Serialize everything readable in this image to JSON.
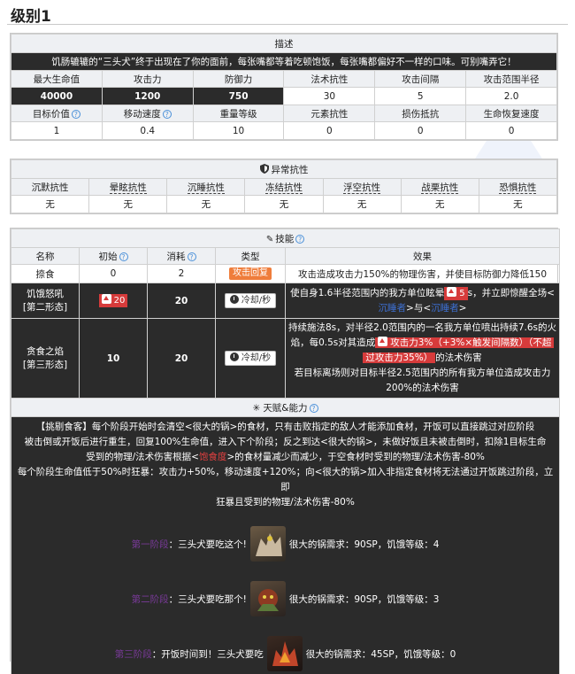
{
  "page": {
    "title": "级别1"
  },
  "desc": {
    "header": "描述",
    "text": "饥肠辘辘的“三头犬”终于出现在了你的面前，每张嘴都等着吃顿饱饭，每张嘴都偏好不一样的口味。可别嘴弄它！"
  },
  "stats": {
    "row1_labels": [
      "最大生命值",
      "攻击力",
      "防御力",
      "法术抗性",
      "攻击间隔",
      "攻击范围半径"
    ],
    "row1_values": [
      "40000",
      "1200",
      "750",
      "30",
      "5",
      "2.0"
    ],
    "row2_labels": [
      "目标价值",
      "移动速度",
      "重量等级",
      "元素抗性",
      "损伤抵抗",
      "生命恢复速度"
    ],
    "row2_values": [
      "1",
      "0.4",
      "10",
      "0",
      "0",
      "0"
    ]
  },
  "resist": {
    "header": "异常抗性",
    "labels": [
      "沉默抗性",
      "晕眩抗性",
      "沉睡抗性",
      "冻结抗性",
      "浮空抗性",
      "战栗抗性",
      "恐惧抗性"
    ],
    "values": [
      "无",
      "无",
      "无",
      "无",
      "无",
      "无",
      "无"
    ]
  },
  "skills": {
    "header": "技能",
    "cols": [
      "名称",
      "初始",
      "消耗",
      "类型",
      "效果"
    ],
    "row1": {
      "name": "捺食",
      "init": "0",
      "cost": "2",
      "type": "攻击回复",
      "effect": "攻击造成攻击力150%的物理伤害，并使目标防御力降低150"
    },
    "row2": {
      "name1": "饥饿怒吼",
      "name2": "[第二形态]",
      "init": "20",
      "cost": "20",
      "type": "冷却/秒",
      "eff_a": "使自身1.6半径范围内的我方单位眩晕",
      "eff_tag": "5",
      "eff_b": "s，并立即惊醒全场<",
      "eff_link1": "沉睡者",
      "eff_mid": ">与<",
      "eff_link2": "沉睡者",
      "eff_end": ">"
    },
    "row3": {
      "name1": "贪食之焰",
      "name2": "[第三形态]",
      "init": "10",
      "cost": "20",
      "type": "冷却/秒",
      "eff1": "持续施法8s，对半径2.0范围内的一名我方单位喷出持续7.6s的火",
      "eff2a": "焰，每0.5s对其造成",
      "eff2b": "攻击力3%（+3%×触发间隔数）（不超",
      "eff3a": "过攻击力35%）",
      "eff3b": "的法术伤害",
      "eff4": "若目标离场则对目标半径2.5范围内的所有我方单位造成攻击力",
      "eff5": "200%的法术伤害"
    }
  },
  "talent": {
    "header": "天赋&能力",
    "line1": "【挑剔食客】每个阶段开始时会清空<很大的锅>的食材，只有击败指定的敌人才能添加食材，开饭可以直接跳过对应阶段",
    "line2": "被击倒或开饭后进行重生，回复100%生命值，进入下个阶段；反之到达<很大的锅>，未做好饭且未被击倒时，扣除1目标生命",
    "line3a": "受到的物理/法术伤害根据<",
    "line3hl": "饱食度",
    "line3b": ">的食材量减少而减少，于空食材时受到的物理/法术伤害-80%",
    "line4": "每个阶段生命值低于50%时狂暴：攻击力+50%，移动速度+120%；向<很大的锅>加入非指定食材将无法通过开饭跳过阶段，立即",
    "line5": "狂暴且受到的物理/法术伤害-80%"
  },
  "stages": [
    {
      "label": "第一阶段",
      "title": "三头犬要吃这个!",
      "req": "很大的锅需求：90SP，饥饿等级：4"
    },
    {
      "label": "第二阶段",
      "title": "三头犬要吃那个!",
      "req": "很大的锅需求：90SP，饥饿等级：3"
    },
    {
      "label": "第三阶段",
      "title": "开饭时间到！三头犬要吃",
      "req": "很大的锅需求：45SP，饥饿等级：0"
    }
  ]
}
